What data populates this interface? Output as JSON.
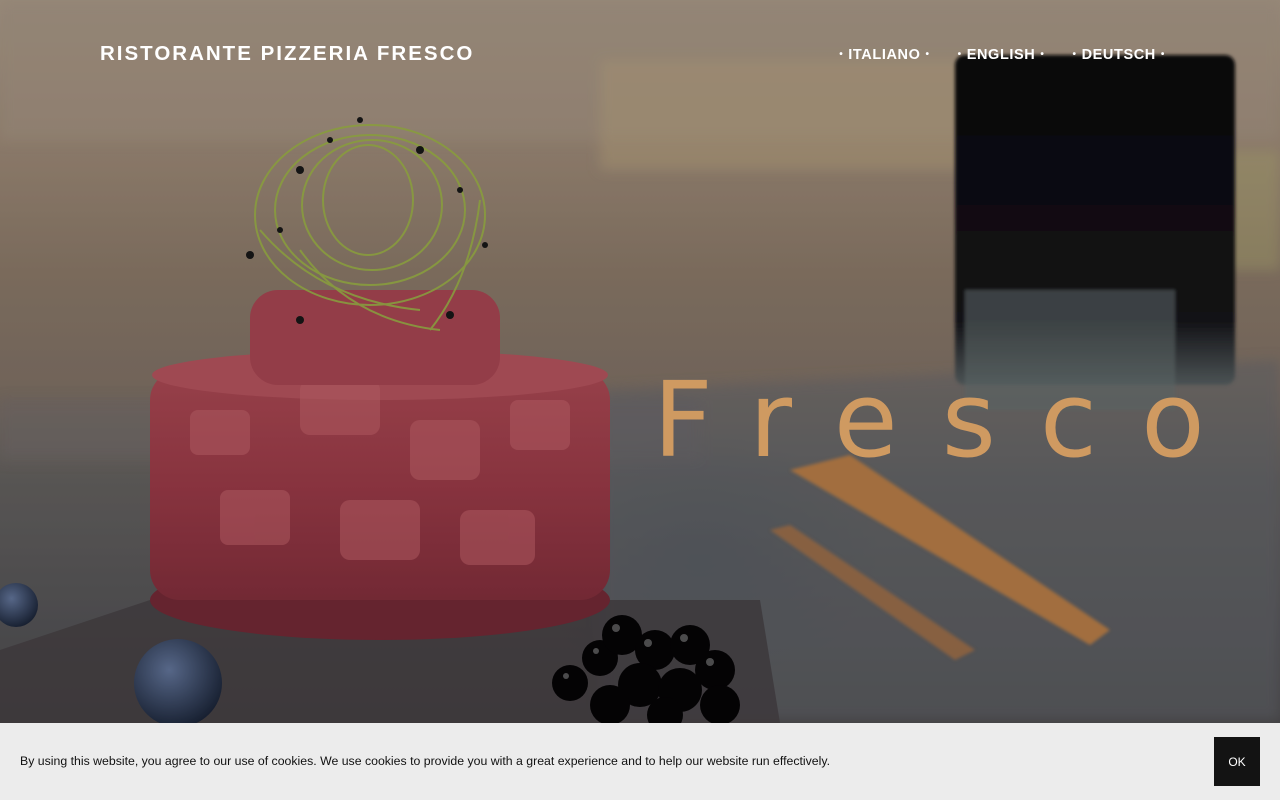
{
  "site": {
    "title": "RISTORANTE PIZZERIA FRESCO"
  },
  "languages": [
    {
      "label": "ITALIANO"
    },
    {
      "label": "ENGLISH"
    },
    {
      "label": "DEUTSCH"
    }
  ],
  "hero": {
    "heading": "Fresco",
    "accent_color": "#cf9a61",
    "image_subject": "tuna tartare with sprouts, blueberries and black caviar beads"
  },
  "cookie_banner": {
    "message": "By using this website, you agree to our use of cookies. We use cookies to provide you with a great experience and to help our website run effectively.",
    "ok_label": "OK",
    "background": "#ececec"
  }
}
